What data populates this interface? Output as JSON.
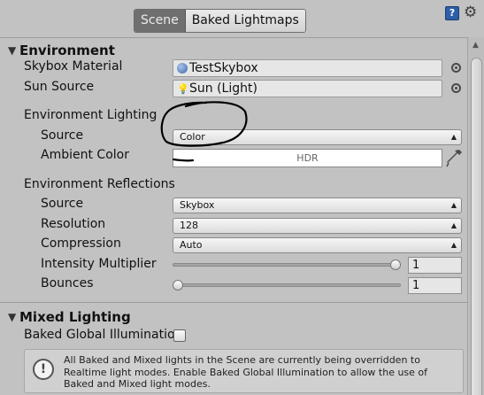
{
  "tabs": [
    {
      "label": "Scene",
      "active": true
    },
    {
      "label": "Baked Lightmaps",
      "active": false
    }
  ],
  "toolbar": {
    "help_icon": "help-book-icon",
    "gear_icon": "gear-icon"
  },
  "environment": {
    "title": "Environment",
    "skybox_material": {
      "label": "Skybox Material",
      "value": "TestSkybox"
    },
    "sun_source": {
      "label": "Sun Source",
      "value": "Sun (Light)"
    },
    "lighting_header": "Environment Lighting",
    "source": {
      "label": "Source",
      "value": "Color"
    },
    "ambient_color": {
      "label": "Ambient Color",
      "badge": "HDR"
    },
    "reflections_header": "Environment Reflections",
    "refl_source": {
      "label": "Source",
      "value": "Skybox"
    },
    "resolution": {
      "label": "Resolution",
      "value": "128"
    },
    "compression": {
      "label": "Compression",
      "value": "Auto"
    },
    "intensity": {
      "label": "Intensity Multiplier",
      "value": "1",
      "fraction": 1.0
    },
    "bounces": {
      "label": "Bounces",
      "value": "1",
      "fraction": 0.0
    }
  },
  "mixed_lighting": {
    "title": "Mixed Lighting",
    "baked_gi": {
      "label": "Baked Global Illuminatio",
      "checked": false
    },
    "help_message": "All Baked and Mixed lights in the Scene are currently being overridden to Realtime light modes. Enable Baked Global Illumination to allow the use of Baked and Mixed light modes."
  },
  "annotation": {
    "color": "#000000"
  }
}
